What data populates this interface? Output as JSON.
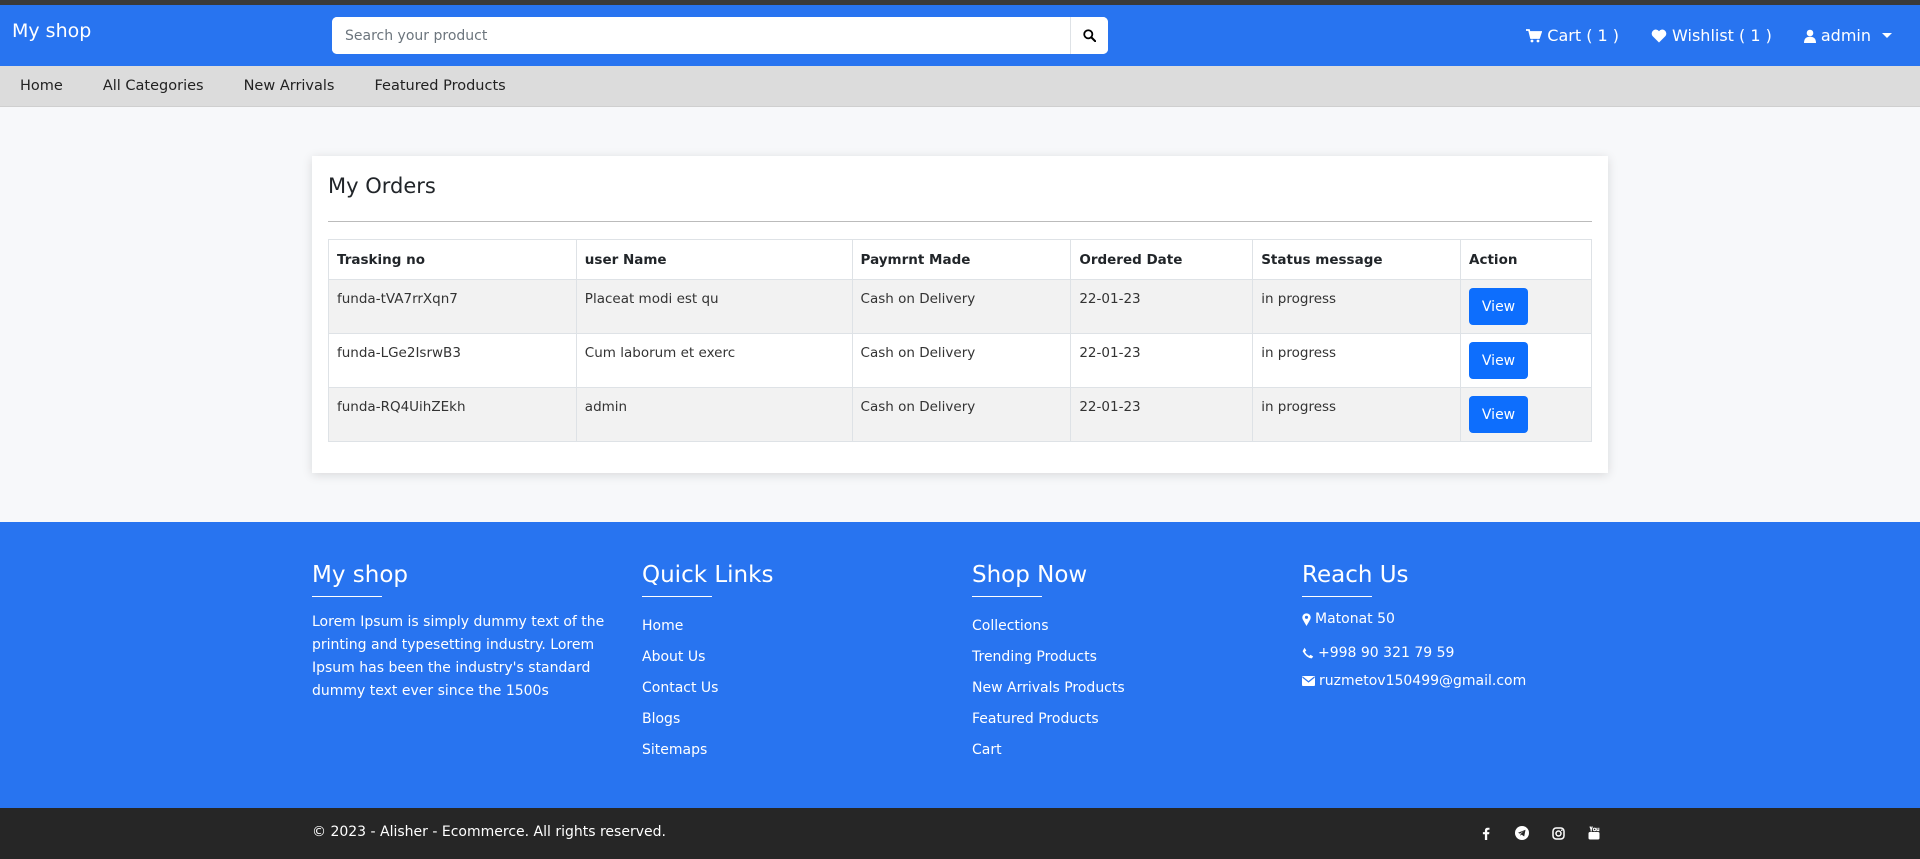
{
  "header": {
    "brand": "My shop",
    "search_placeholder": "Search your product",
    "cart_label": "Cart ( 1 )",
    "wishlist_label": "Wishlist ( 1 )",
    "user_label": "admin"
  },
  "subnav": [
    "Home",
    "All Categories",
    "New Arrivals",
    "Featured Products"
  ],
  "orders": {
    "title": "My Orders",
    "columns": [
      "Trasking no",
      "user Name",
      "Paymrnt Made",
      "Ordered Date",
      "Status message",
      "Action"
    ],
    "rows": [
      {
        "tracking": "funda-tVA7rrXqn7",
        "user": "Placeat modi est qu",
        "payment": "Cash on Delivery",
        "date": "22-01-23",
        "status": "in progress",
        "action": "View"
      },
      {
        "tracking": "funda-LGe2IsrwB3",
        "user": "Cum laborum et exerc",
        "payment": "Cash on Delivery",
        "date": "22-01-23",
        "status": "in progress",
        "action": "View"
      },
      {
        "tracking": "funda-RQ4UihZEkh",
        "user": "admin",
        "payment": "Cash on Delivery",
        "date": "22-01-23",
        "status": "in progress",
        "action": "View"
      }
    ]
  },
  "footer": {
    "about": {
      "title": "My shop",
      "text": "Lorem Ipsum is simply dummy text of the printing and typesetting industry. Lorem Ipsum has been the industry's standard dummy text ever since the 1500s"
    },
    "quick_links": {
      "title": "Quick Links",
      "items": [
        "Home",
        "About Us",
        "Contact Us",
        "Blogs",
        "Sitemaps"
      ]
    },
    "shop_now": {
      "title": "Shop Now",
      "items": [
        "Collections",
        "Trending Products",
        "New Arrivals Products",
        "Featured Products",
        "Cart"
      ]
    },
    "reach_us": {
      "title": "Reach Us",
      "address": "Matonat 50",
      "phone": "+998 90 321 79 59",
      "email": "ruzmetov150499@gmail.com"
    }
  },
  "bottom": {
    "copyright": "© 2023 - Alisher - Ecommerce. All rights reserved.",
    "social_icons": [
      "facebook-icon",
      "telegram-icon",
      "instagram-icon",
      "youtube-icon"
    ]
  },
  "colors": {
    "primary": "#2874f0",
    "button": "#0d6efd",
    "bottom_bar": "#262626",
    "subnav": "#dcdcdc"
  }
}
